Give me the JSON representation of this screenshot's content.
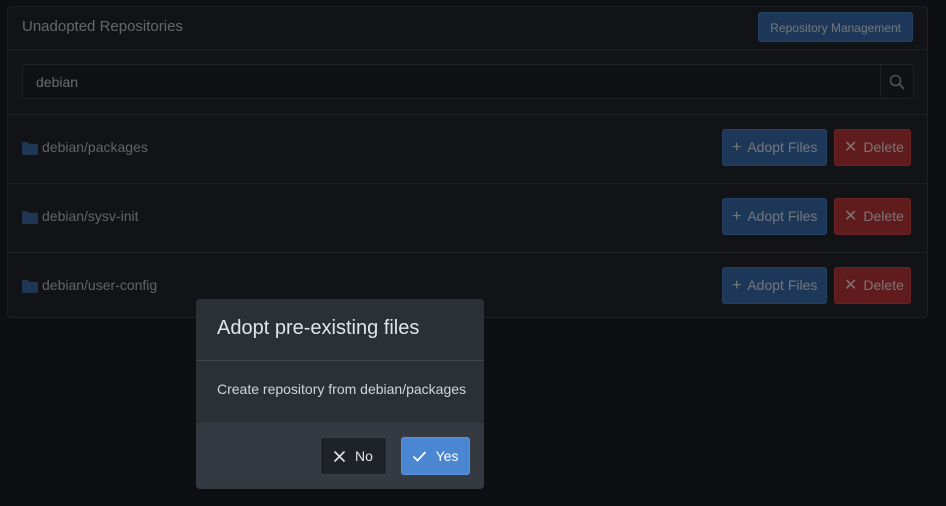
{
  "panel": {
    "title": "Unadopted Repositories",
    "management_button": "Repository Management"
  },
  "search": {
    "value": "debian",
    "icon": "search-icon"
  },
  "repos": [
    {
      "name": "debian/packages",
      "adopt_label": "Adopt Files",
      "delete_label": "Delete"
    },
    {
      "name": "debian/sysv-init",
      "adopt_label": "Adopt Files",
      "delete_label": "Delete"
    },
    {
      "name": "debian/user-config",
      "adopt_label": "Adopt Files",
      "delete_label": "Delete"
    }
  ],
  "modal": {
    "title": "Adopt pre-existing files",
    "text": "Create repository from debian/packages",
    "no_label": "No",
    "yes_label": "Yes"
  },
  "colors": {
    "background": "#1c1f25",
    "primary": "#3a6fb0",
    "danger": "#c0383a",
    "yes_button": "#4a86d1"
  }
}
